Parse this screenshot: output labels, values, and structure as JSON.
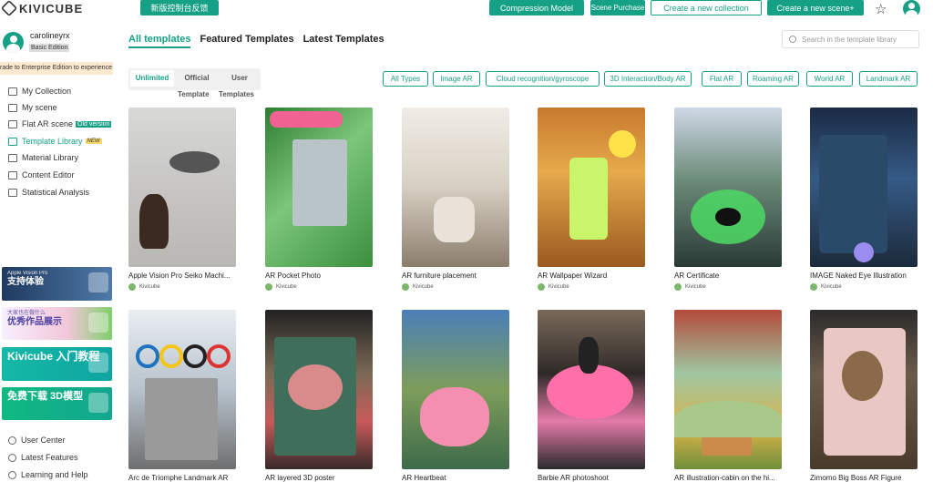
{
  "topbar": {
    "logo_text": "KIVICUBE",
    "feedback_label": "新版控制台反馈",
    "compression_label": "Compression Model",
    "scene_purchase_label": "Scene Purchase",
    "create_collection_label": "Create a new collection",
    "create_scene_label": "Create a new scene+"
  },
  "user": {
    "name": "carolineyrx",
    "edition": "Basic Edition",
    "upgrade_text": "rade to Enterprise Edition to experience mo"
  },
  "sidebar": {
    "items": [
      {
        "label": "My Collection"
      },
      {
        "label": "My scene"
      },
      {
        "label": "Flat AR scene",
        "badge": "Old version"
      },
      {
        "label": "Template Library",
        "badge": "NEW"
      },
      {
        "label": "Material Library"
      },
      {
        "label": "Content Editor"
      },
      {
        "label": "Statistical Analysis"
      }
    ],
    "banners": [
      {
        "small": "Apple Vision Pro",
        "text": "支持体验"
      },
      {
        "small": "大家也在做什么",
        "text": "优秀作品展示"
      },
      {
        "small": "",
        "text": "Kivicube 入门教程"
      },
      {
        "small": "",
        "text": "免费下载 3D模型"
      }
    ],
    "bottom": [
      {
        "label": "User Center"
      },
      {
        "label": "Latest Features"
      },
      {
        "label": "Learning and Help"
      }
    ]
  },
  "main": {
    "tabs": [
      {
        "label": "All templates"
      },
      {
        "label": "Featured Templates"
      },
      {
        "label": "Latest Templates"
      }
    ],
    "search_placeholder": "Search in the template library",
    "segment": [
      {
        "label": "Unlimited"
      },
      {
        "label": "Official",
        "sub": "Template"
      },
      {
        "label": "User",
        "sub": "Templates"
      }
    ],
    "filters": [
      {
        "label": "All Types"
      },
      {
        "label": "Image AR"
      },
      {
        "label": "Cloud recognition/gyroscope"
      },
      {
        "label": "3D Interaction/Body AR"
      },
      {
        "label": "Flat AR"
      },
      {
        "label": "Roaming AR"
      },
      {
        "label": "World AR"
      },
      {
        "label": "Landmark AR"
      }
    ],
    "templates": [
      {
        "title": "Apple Vision Pro Seiko Machi...",
        "author": "Kivicube"
      },
      {
        "title": "AR Pocket Photo",
        "author": "Kivicube"
      },
      {
        "title": "AR furniture placement",
        "author": "Kivicube"
      },
      {
        "title": "AR Wallpaper Wizard",
        "author": "Kivicube"
      },
      {
        "title": "AR Certificate",
        "author": "Kivicube"
      },
      {
        "title": "IMAGE Naked Eye Illustration",
        "author": "Kivicube"
      },
      {
        "title": "Arc de Triomphe Landmark AR",
        "author": ""
      },
      {
        "title": "AR layered 3D poster",
        "author": ""
      },
      {
        "title": "AR Heartbeat",
        "author": ""
      },
      {
        "title": "Barbie AR photoshoot",
        "author": ""
      },
      {
        "title": "AR illustration-cabin on the hi...",
        "author": ""
      },
      {
        "title": "Zimomo Big Boss AR Figure",
        "author": ""
      }
    ]
  },
  "colors": {
    "accent": "#16a085"
  }
}
